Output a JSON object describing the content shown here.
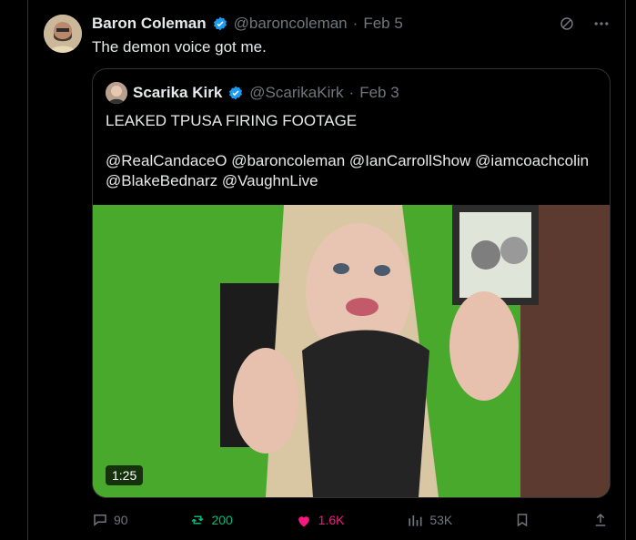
{
  "post": {
    "author_name": "Baron Coleman",
    "author_handle": "@baroncoleman",
    "date_sep": "·",
    "date": "Feb 5",
    "text": "The demon voice got me."
  },
  "quote": {
    "author_name": "Scarika Kirk",
    "author_handle": "@ScarikaKirk",
    "date_sep": "·",
    "date": "Feb 3",
    "text": "LEAKED TPUSA FIRING FOOTAGE\n\n@RealCandaceO @baroncoleman @IanCarrollShow @iamcoachcolin\n@BlakeBednarz @VaughnLive",
    "video_duration": "1:25"
  },
  "actions": {
    "replies": "90",
    "reposts": "200",
    "likes": "1.6K",
    "views": "53K"
  },
  "colors": {
    "verified": "#1d9bf0",
    "repost": "#00ba7c",
    "like": "#f91880"
  },
  "icons": {
    "grok": "grok-icon",
    "more": "more-icon",
    "reply": "reply-icon",
    "repost": "repost-icon",
    "like": "heart-icon",
    "views": "views-icon",
    "bookmark": "bookmark-icon",
    "share": "share-icon"
  }
}
